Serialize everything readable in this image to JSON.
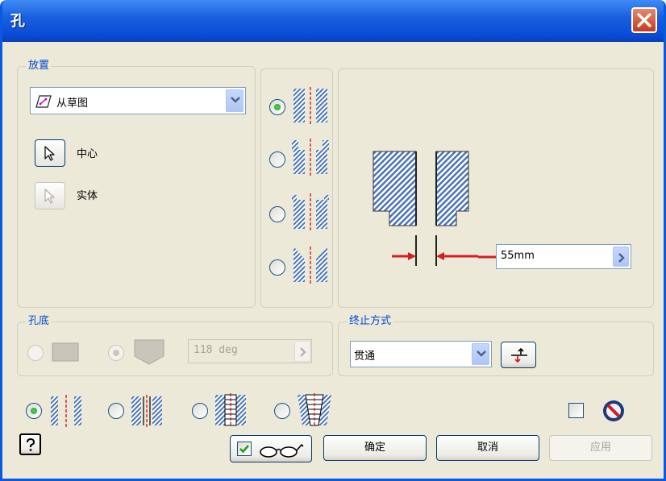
{
  "window": {
    "title": "孔"
  },
  "placement": {
    "title": "放置",
    "dropdown_value": "从草图",
    "center_label": "中心",
    "solid_label": "实体"
  },
  "hole_types": [
    "drilled-hole-icon",
    "counterbore-hole-icon",
    "spotface-hole-icon",
    "countersink-hole-icon"
  ],
  "diameter": {
    "value": "55mm"
  },
  "drill_point": {
    "title": "孔底",
    "angle": "118 deg"
  },
  "termination": {
    "title": "终止方式",
    "value": "贯通"
  },
  "thread_types": [
    "simple-hole-icon",
    "clearance-hole-icon",
    "tapped-hole-icon",
    "taper-tapped-hole-icon"
  ],
  "buttons": {
    "ok": "确定",
    "cancel": "取消",
    "apply": "应用"
  },
  "colors": {
    "title_bar": "#1b60e0",
    "group_title": "#0046d5",
    "dimension_arrow": "#d21f1f"
  }
}
